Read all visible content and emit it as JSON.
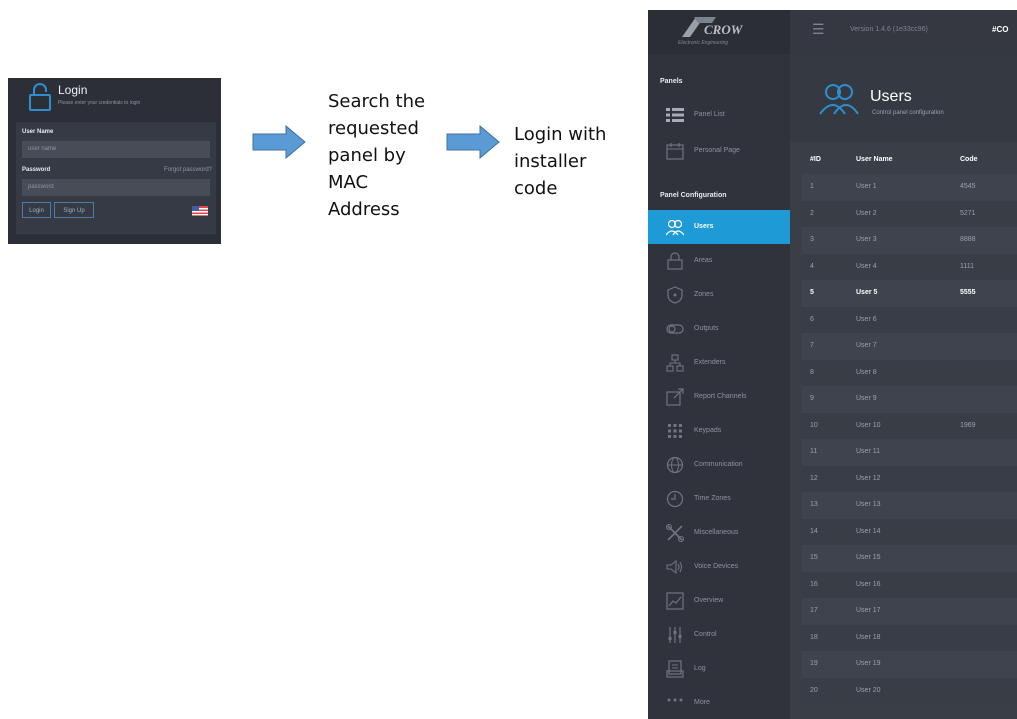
{
  "login": {
    "title": "Login",
    "subtitle": "Please enter your credentials to login",
    "username_label": "User Name",
    "username_placeholder": "user name",
    "password_label": "Password",
    "forgot_link": "Forgot password?",
    "password_placeholder": "password",
    "login_button": "Login",
    "signup_button": "Sign Up"
  },
  "steps": {
    "step1": [
      "Search the",
      "requested",
      "panel by",
      "MAC",
      "Address"
    ],
    "step2": [
      "Login with",
      "installer",
      "code"
    ]
  },
  "app": {
    "logo_text": "CROW",
    "logo_subtitle": "Electronic Engineering",
    "version": "Version 1.4.6 (1e33cc96)",
    "hashtag": "#CO",
    "sidebar": {
      "panels_header": "Panels",
      "panels_items": [
        {
          "label": "Panel List",
          "icon": "list-icon"
        },
        {
          "label": "Personal Page",
          "icon": "calendar-icon"
        }
      ],
      "config_header": "Panel Configuration",
      "config_items": [
        {
          "label": "Users",
          "icon": "users-icon"
        },
        {
          "label": "Areas",
          "icon": "lock-icon"
        },
        {
          "label": "Zones",
          "icon": "shield-icon"
        },
        {
          "label": "Outputs",
          "icon": "toggle-icon"
        },
        {
          "label": "Extenders",
          "icon": "network-icon"
        },
        {
          "label": "Report Channels",
          "icon": "report-icon"
        },
        {
          "label": "Keypads",
          "icon": "keypad-icon"
        },
        {
          "label": "Communication",
          "icon": "globe-icon"
        },
        {
          "label": "Time Zones",
          "icon": "clock-icon"
        },
        {
          "label": "Miscellaneous",
          "icon": "tools-icon"
        },
        {
          "label": "Voice Devices",
          "icon": "speaker-icon"
        },
        {
          "label": "Overview",
          "icon": "chart-icon"
        },
        {
          "label": "Control",
          "icon": "sliders-icon"
        },
        {
          "label": "Log",
          "icon": "log-icon"
        },
        {
          "label": "More",
          "icon": "more-icon"
        }
      ]
    },
    "page": {
      "title": "Users",
      "subtitle": "Control panel configuration"
    },
    "table": {
      "headers": [
        "#ID",
        "User Name",
        "Code"
      ],
      "rows": [
        [
          "1",
          "User 1",
          "4545"
        ],
        [
          "2",
          "User 2",
          "5271"
        ],
        [
          "3",
          "User 3",
          "8888"
        ],
        [
          "4",
          "User 4",
          "1111"
        ],
        [
          "5",
          "User 5",
          "5555"
        ],
        [
          "6",
          "User 6",
          ""
        ],
        [
          "7",
          "User 7",
          ""
        ],
        [
          "8",
          "User 8",
          ""
        ],
        [
          "9",
          "User 9",
          ""
        ],
        [
          "10",
          "User 10",
          "1969"
        ],
        [
          "11",
          "User 11",
          ""
        ],
        [
          "12",
          "User 12",
          ""
        ],
        [
          "13",
          "User 13",
          ""
        ],
        [
          "14",
          "User 14",
          ""
        ],
        [
          "15",
          "User 15",
          ""
        ],
        [
          "16",
          "User 16",
          ""
        ],
        [
          "17",
          "User 17",
          ""
        ],
        [
          "18",
          "User 18",
          ""
        ],
        [
          "19",
          "User 19",
          ""
        ],
        [
          "20",
          "User 20",
          ""
        ]
      ]
    }
  },
  "colors": {
    "accent": "#1e9ad6",
    "sidebar_bg": "#30333b",
    "arrow": "#5b9bd5"
  }
}
